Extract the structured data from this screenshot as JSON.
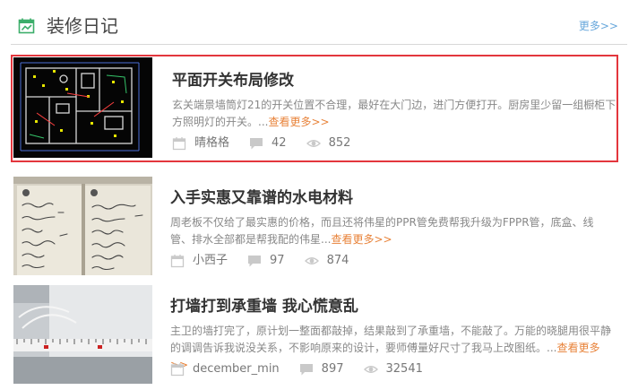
{
  "header": {
    "title": "装修日记",
    "more": "更多>>",
    "accent": "#3cae6a"
  },
  "colors": {
    "active_border": "#e3363d",
    "read_more": "#e8833a",
    "more_link": "#67a7db",
    "meta_icon": "#c9c9c9"
  },
  "items": [
    {
      "title": "平面开关布局修改",
      "desc": "玄关端景墙筒灯21的开关位置不合理，最好在大门边，进门方便打开。厨房里少留一组橱柜下方照明灯的开关。...",
      "read_more": "查看更多>>",
      "author": "晴格格",
      "comments": "42",
      "views": "852",
      "thumbnail": "floor-plan-image",
      "active": true
    },
    {
      "title": "入手实惠又靠谱的水电材料",
      "desc": "周老板不仅给了最实惠的价格，而且还将伟星的PPR管免费帮我升级为FPPR管，底盒、线管、排水全部都是帮我配的伟星...",
      "read_more": "查看更多>>",
      "author": "小西子",
      "comments": "97",
      "views": "874",
      "thumbnail": "handwritten-notebook-image",
      "active": false
    },
    {
      "title": "打墙打到承重墙 我心慌意乱",
      "desc": "主卫的墙打完了，原计划一整面都敲掉，结果敲到了承重墙，不能敲了。万能的晓腿用很平静的调调告诉我说没关系，不影响原来的设计，要师傅量好尺寸了我马上改图纸。...",
      "read_more": "查看更多>>",
      "author": "december_min",
      "comments": "897",
      "views": "32541",
      "thumbnail": "wall-measuring-tape-image",
      "active": false
    }
  ]
}
